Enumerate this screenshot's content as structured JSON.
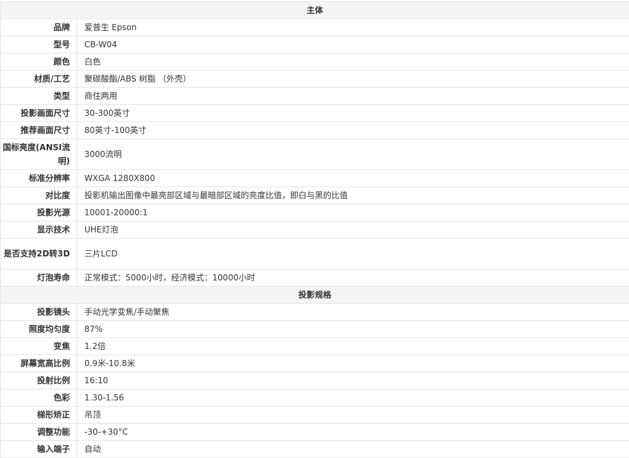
{
  "sections": [
    {
      "title": "主体",
      "rows": [
        {
          "key": "品牌",
          "value": "爱普生 Epson"
        },
        {
          "key": "型号",
          "value": "CB-W04"
        },
        {
          "key": "颜色",
          "value": "白色"
        },
        {
          "key": "材质/工艺",
          "value": "聚碳酸酯/ABS 树脂 （外壳）"
        },
        {
          "key": "类型",
          "value": "商住两用"
        },
        {
          "key": "投影画面尺寸",
          "value": "30-300英寸"
        },
        {
          "key": "推荐画面尺寸",
          "value": "80英寸-100英寸"
        },
        {
          "key": "国标亮度(ANSI流明)",
          "value": "3000流明"
        },
        {
          "key": "标准分辨率",
          "value": "WXGA 1280X800"
        },
        {
          "key": "对比度",
          "value": "投影机输出图像中最亮部区域与最暗部区域的亮度比值，即白与黑的比值"
        },
        {
          "key": "投影光源",
          "value": "10001-20000:1"
        },
        {
          "key": "显示技术",
          "value": "UHE灯泡"
        },
        {
          "key": "是否支持2D转3D",
          "value": "三片LCD"
        },
        {
          "key": "灯泡寿命",
          "value": "正常模式：5000小时，经济模式：10000小时"
        }
      ]
    },
    {
      "title": "投影规格",
      "rows": [
        {
          "key": "投影镜头",
          "value": "手动光学变焦/手动聚焦"
        },
        {
          "key": "照度均匀度",
          "value": "87%"
        },
        {
          "key": "变焦",
          "value": "1.2倍"
        },
        {
          "key": "屏幕宽高比例",
          "value": "0.9米-10.8米"
        },
        {
          "key": "投射比例",
          "value": "16:10"
        },
        {
          "key": "色彩",
          "value": "1.30-1.56"
        },
        {
          "key": "梯形矫正",
          "value": "吊顶"
        },
        {
          "key": "调整功能",
          "value": "-30-+30°C"
        },
        {
          "key": "输入端子",
          "value": "自动"
        }
      ]
    }
  ]
}
